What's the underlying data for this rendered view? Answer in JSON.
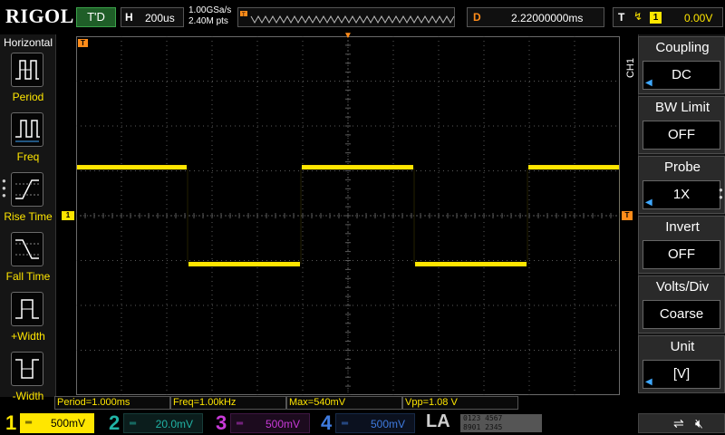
{
  "header": {
    "logo": "RIGOL",
    "trigger_status": "T'D",
    "timebase_label": "H",
    "timebase_value": "200us",
    "sample_rate": "1.00GSa/s",
    "memory_depth": "2.40M pts",
    "delay_label": "D",
    "delay_value": "2.22000000ms",
    "trigger_label": "T",
    "trigger_source": "1",
    "trigger_level": "0.00V"
  },
  "left_menu": {
    "title": "Horizontal",
    "items": [
      {
        "label": "Period",
        "icon": "period-icon"
      },
      {
        "label": "Freq",
        "icon": "freq-icon"
      },
      {
        "label": "Rise Time",
        "icon": "rise-time-icon"
      },
      {
        "label": "Fall Time",
        "icon": "fall-time-icon"
      },
      {
        "label": "+Width",
        "icon": "pos-width-icon"
      },
      {
        "label": "-Width",
        "icon": "neg-width-icon"
      }
    ]
  },
  "markers": {
    "ch1_offset": "1",
    "trigger_level": "T",
    "trigger_position": "T"
  },
  "measurements": [
    "Period=1.000ms",
    "Freq=1.00kHz",
    "Max=540mV",
    "Vpp=1.08 V"
  ],
  "right_menu": {
    "channel_tag": "CH1",
    "items": [
      {
        "title": "Coupling",
        "value": "DC",
        "has_arrow": true
      },
      {
        "title": "BW Limit",
        "value": "OFF",
        "has_arrow": false
      },
      {
        "title": "Probe",
        "value": "1X",
        "has_arrow": true
      },
      {
        "title": "Invert",
        "value": "OFF",
        "has_arrow": false
      },
      {
        "title": "Volts/Div",
        "value": "Coarse",
        "has_arrow": false
      },
      {
        "title": "Unit",
        "value": "[V]",
        "has_arrow": true
      }
    ]
  },
  "channels": [
    {
      "num": "1",
      "coupling": "═",
      "scale": "500mV",
      "color": "#ffe600",
      "active": true
    },
    {
      "num": "2",
      "coupling": "═",
      "scale": "20.0mV",
      "color": "#21b3a5",
      "active": false
    },
    {
      "num": "3",
      "coupling": "═",
      "scale": "500mV",
      "color": "#c83ad8",
      "active": false
    },
    {
      "num": "4",
      "coupling": "═",
      "scale": "500mV",
      "color": "#3f7bdf",
      "active": false
    }
  ],
  "la": {
    "label": "LA",
    "digits_row1": "0123 4567",
    "digits_row2": "8901 2345"
  },
  "colors": {
    "ch1": "#ffe600",
    "trigger": "#ff8c1a",
    "grid": "#5a5a5a"
  },
  "waveform": {
    "type": "square",
    "frequency_hz": 1000,
    "high_v": 0.54,
    "low_v": -0.54,
    "volts_per_div": 0.5
  }
}
